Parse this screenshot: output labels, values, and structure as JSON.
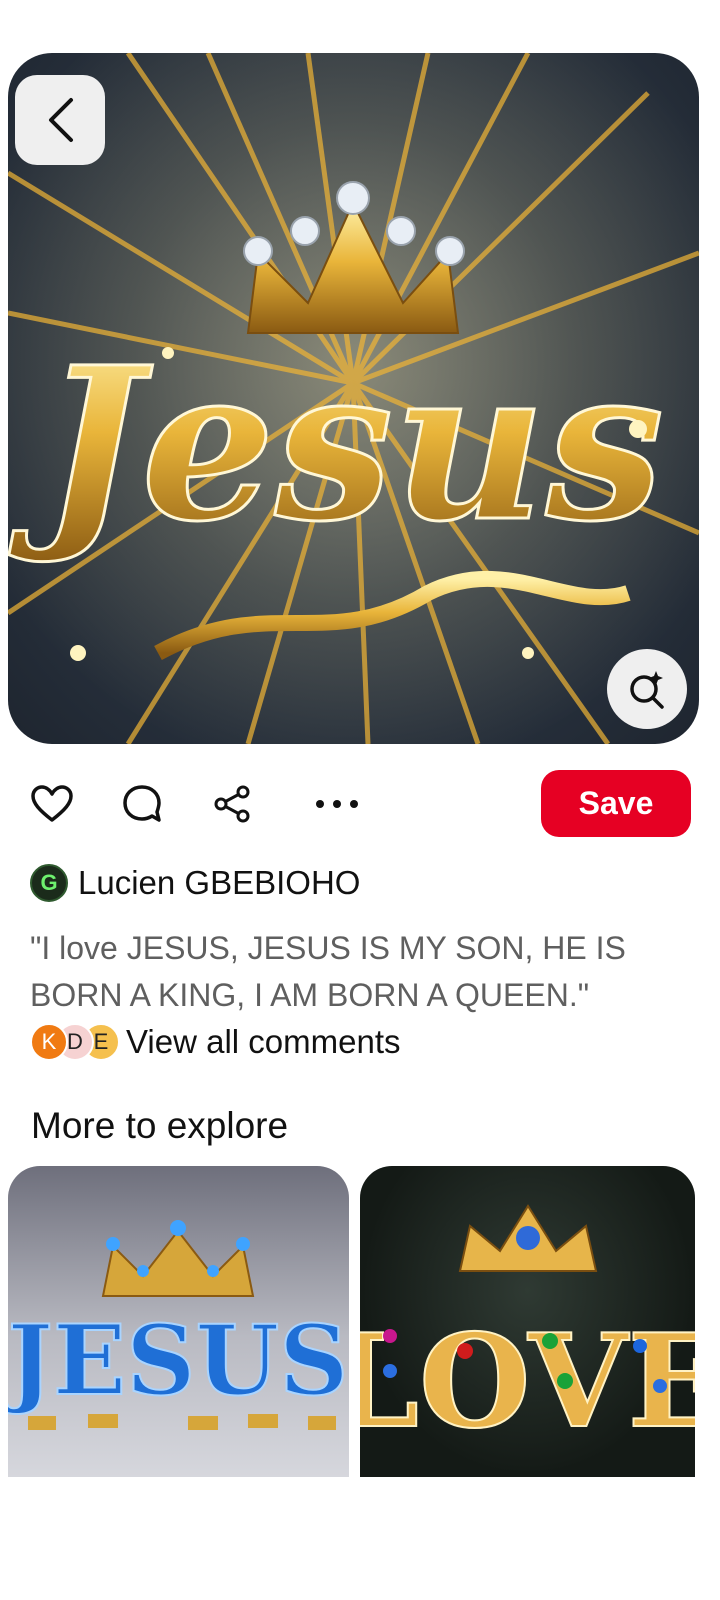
{
  "pin": {
    "image_text": "Jesus",
    "back_icon": "chevron-left-icon",
    "lens_icon": "visual-search-icon"
  },
  "actions": {
    "like_icon": "heart-icon",
    "comment_icon": "comment-icon",
    "share_icon": "share-icon",
    "more_icon": "more-icon",
    "save_label": "Save"
  },
  "creator": {
    "avatar_letter": "G",
    "name": "Lucien GBEBIOHO"
  },
  "description": "\"I love JESUS, JESUS IS MY SON, HE IS BORN A KING, I AM BORN A QUEEN.\"",
  "comments": {
    "avatars": [
      "K",
      "D",
      "E"
    ],
    "label": "View all comments"
  },
  "explore": {
    "title": "More to explore",
    "items": [
      {
        "image_text": "JESUS"
      },
      {
        "image_text": "LOVE"
      }
    ]
  },
  "colors": {
    "save": "#e60023",
    "gold": "#f3c24a",
    "blue_text": "#1f6fd6"
  }
}
